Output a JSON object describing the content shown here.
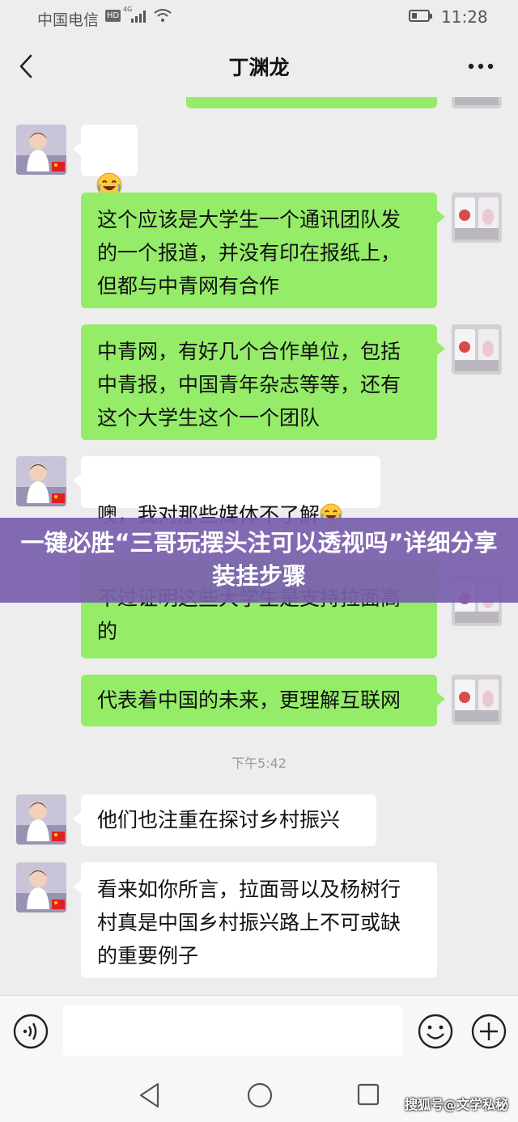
{
  "status_bar": {
    "carrier": "中国电信",
    "hd": "HD",
    "network": "4G",
    "time": "11:28",
    "battery_level": 0.35
  },
  "header": {
    "title": "丁渊龙"
  },
  "messages": [
    {
      "side": "in",
      "text": ""
    },
    {
      "side": "out",
      "text": "这个应该是大学生一个通讯团队发\n的一个报道，并没有印在报纸上，\n但都与中青网有合作"
    },
    {
      "side": "out",
      "text": "中青网，有好几个合作单位，包括\n中青报，中国青年杂志等等，还有\n这个大学生这个一个团队"
    },
    {
      "side": "in",
      "text": "噢，我对那些媒体不了解"
    },
    {
      "side": "out",
      "text": "不过证明这些大学生是支持拉面高\n的"
    },
    {
      "side": "out",
      "text": "代表着中国的未来，更理解互联网"
    },
    {
      "side": "in",
      "text": "他们也注重在探讨乡村振兴"
    },
    {
      "side": "in",
      "text": "看来如你所言，拉面哥以及杨树行\n村真是中国乡村振兴路上不可或缺\n的重要例子"
    }
  ],
  "timestamp": "下午5:42",
  "banner": {
    "text": "一键必胜“三哥玩摆头注可以透视吗”详细分享装挂步骤"
  },
  "input": {
    "value": ""
  },
  "watermark": "搜狐号@文学私秘",
  "colors": {
    "background": "#ededed",
    "outgoing_bubble": "#95ec69",
    "incoming_bubble": "#ffffff",
    "banner": "#7a60ae"
  },
  "icons": [
    "back-icon",
    "more-icon",
    "voice-icon",
    "emoji-icon",
    "plus-icon",
    "nav-back-icon",
    "nav-home-icon",
    "nav-recent-icon",
    "laughing-emoji"
  ]
}
